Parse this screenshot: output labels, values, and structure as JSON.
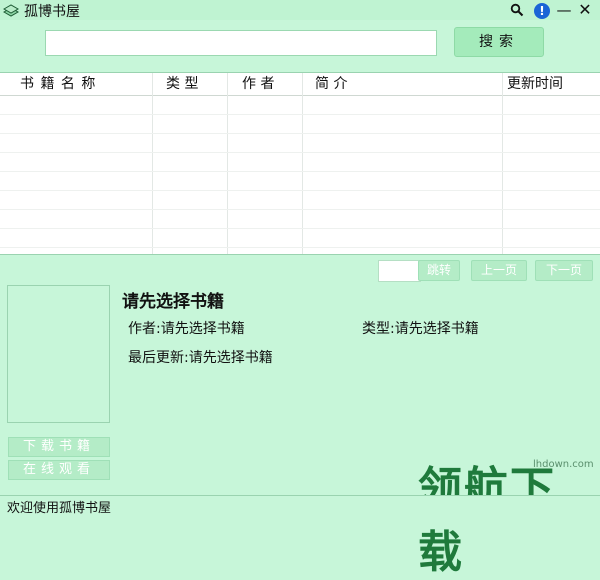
{
  "window": {
    "title": "孤博书屋",
    "search_icon": "search-icon",
    "info_icon": "info-icon",
    "minimize_label": "—",
    "close_label": "✕"
  },
  "search": {
    "value": "",
    "button_label": "搜索"
  },
  "table": {
    "columns": [
      "书 籍 名 称",
      "类 型",
      "作 者",
      "简 介",
      "更新时间"
    ],
    "rows": []
  },
  "pager": {
    "jump_value": "",
    "jump_label": "跳转",
    "prev_label": "上一页",
    "next_label": "下一页"
  },
  "detail": {
    "title": "请先选择书籍",
    "author": "作者:请先选择书籍",
    "type": "类型:请先选择书籍",
    "updated": "最后更新:请先选择书籍"
  },
  "actions": {
    "download_label": "下载书籍",
    "online_label": "在线观看"
  },
  "watermark": {
    "text": "领航下载",
    "site": "lhdown.com"
  },
  "status": {
    "text": "欢迎使用孤博书屋"
  },
  "colors": {
    "background": "#c7f6d9",
    "button": "#a4ebbb",
    "accent": "#1a64d6"
  }
}
